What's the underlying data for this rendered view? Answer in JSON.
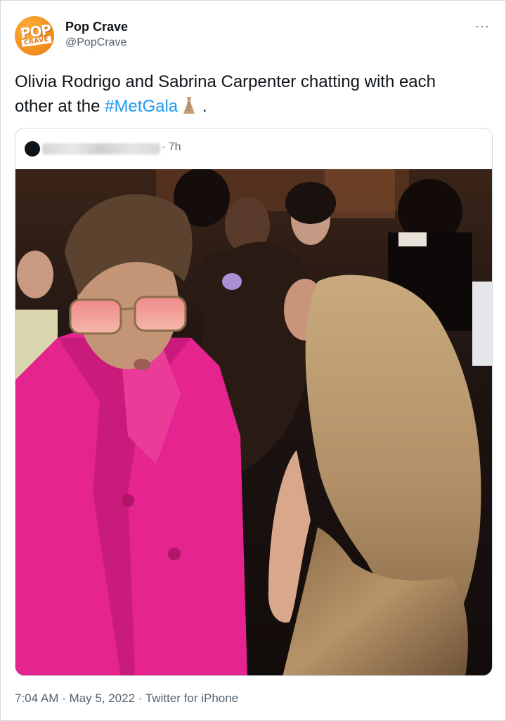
{
  "author": {
    "display_name": "Pop Crave",
    "handle": "@PopCrave",
    "avatar_text_top": "POP",
    "avatar_text_bottom": "CRAVE"
  },
  "more_label": "···",
  "tweet": {
    "text_before": "Olivia Rodrigo and Sabrina Carpenter chatting with each other at the ",
    "hashtag": "#MetGala",
    "text_after": " ."
  },
  "quoted_tweet": {
    "time": "· 7h"
  },
  "footer": {
    "time": "7:04 AM",
    "date": "May 5, 2022",
    "source": "Twitter for iPhone",
    "separator": " · "
  },
  "colors": {
    "link": "#1d9bf0",
    "secondary_text": "#536471",
    "border": "#cfd9de"
  }
}
